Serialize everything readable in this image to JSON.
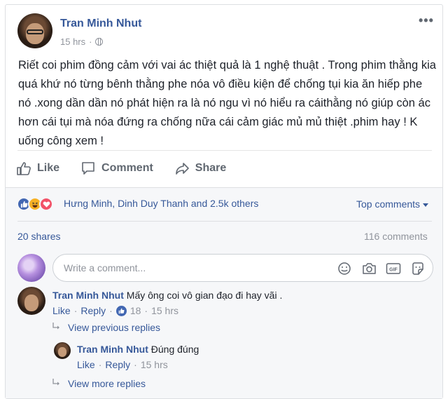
{
  "post": {
    "author": "Tran Minh Nhut",
    "time": "15 hrs",
    "privacy_icon": "globe-icon",
    "options_label": "•••",
    "text": "Riết coi phim đồng cảm với vai ác thiệt quả là 1 nghệ thuật . Trong phim thằng kia quá khứ nó từng bênh thằng phe nóa vô điều kiện để chống tụi kia ăn hiếp phe nó .xong dần dần nó phát hiện ra là nó ngu vì nó hiểu ra cáithằng nó giúp còn ác hơn cái tụi mà nóa đứng ra chống nữa cái cảm giác mủ mủ thiệt .phim hay ! K uống công xem !"
  },
  "actions": {
    "like": "Like",
    "comment": "Comment",
    "share": "Share"
  },
  "reactions": {
    "names": "Hưng Minh, Dinh Duy Thanh and 2.5k others",
    "icons": [
      "like-reaction-icon",
      "haha-reaction-icon",
      "love-reaction-icon"
    ],
    "colors": {
      "like": "#4267b2",
      "haha": "#f7b125",
      "love": "#f25268"
    }
  },
  "sort": {
    "label": "Top comments"
  },
  "stats": {
    "shares": "20 shares",
    "comments": "116 comments"
  },
  "composer": {
    "placeholder": "Write a comment...",
    "icons": [
      "emoji-icon",
      "camera-icon",
      "gif-icon",
      "sticker-icon"
    ],
    "gif_label": "GIF"
  },
  "comments": [
    {
      "author": "Tran Minh Nhut",
      "text": "Mấy ông coi vô gian đạo đi hay vãi .",
      "like_label": "Like",
      "reply_label": "Reply",
      "like_count": "18",
      "time": "15 hrs",
      "view_previous": "View previous replies",
      "reply": {
        "author": "Tran Minh Nhut",
        "text": "Đúng đúng",
        "like_label": "Like",
        "reply_label": "Reply",
        "time": "15 hrs"
      },
      "view_more": "View more replies"
    }
  ],
  "colors": {
    "link": "#365899",
    "muted": "#90949c",
    "brand": "#4267b2"
  }
}
